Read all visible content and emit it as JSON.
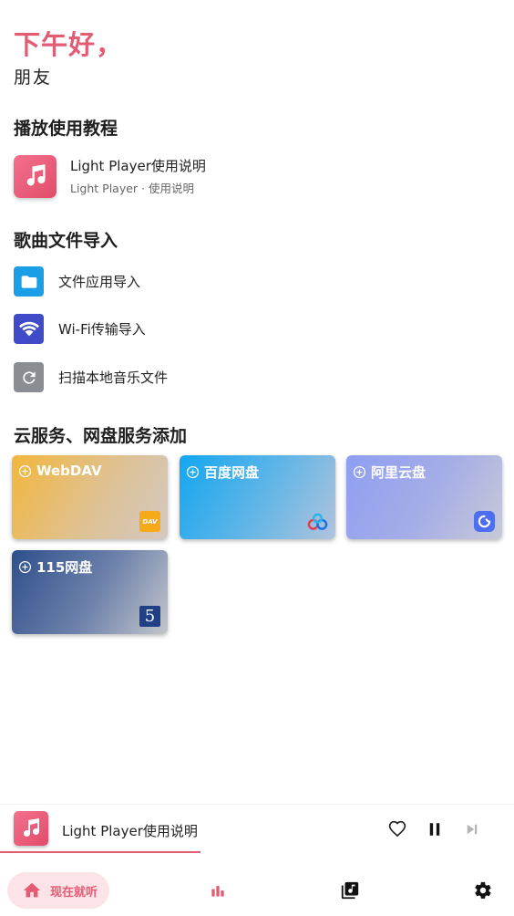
{
  "greeting": {
    "title": "下午好，",
    "subtitle": "朋友"
  },
  "sections": {
    "tutorial": "播放使用教程",
    "import": "歌曲文件导入",
    "cloud": "云服务、网盘服务添加"
  },
  "tutorial": {
    "title": "Light Player使用说明",
    "subtitle": "Light Player · 使用说明"
  },
  "import_items": [
    {
      "label": "文件应用导入",
      "icon": "folder-icon",
      "color": "#1a9fe6"
    },
    {
      "label": "Wi-Fi传输导入",
      "icon": "wifi-icon",
      "color": "#3f4bc8"
    },
    {
      "label": "扫描本地音乐文件",
      "icon": "refresh-icon",
      "color": "#8a8d91"
    }
  ],
  "cloud_cards": [
    {
      "label": "WebDAV",
      "logo": "dav-logo-icon",
      "logo_text": "DAV"
    },
    {
      "label": "百度网盘",
      "logo": "baidu-cloud-logo-icon"
    },
    {
      "label": "阿里云盘",
      "logo": "aliyun-drive-logo-icon"
    },
    {
      "label": "115网盘",
      "logo": "115-logo-icon",
      "logo_text": "5"
    }
  ],
  "player": {
    "title": "Light Player使用说明",
    "progress": 0.39
  },
  "nav": {
    "home_label": "现在就听"
  },
  "colors": {
    "accent": "#e45c74",
    "accent_light": "#fbe3e7"
  }
}
